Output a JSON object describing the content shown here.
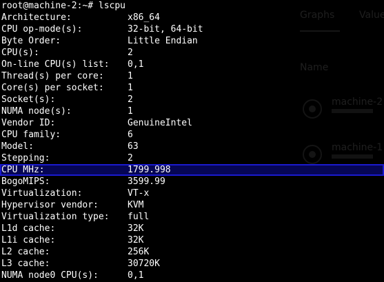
{
  "terminal": {
    "prompt": "root@machine-2:~# lscpu",
    "rows": [
      {
        "key": "Architecture:",
        "value": "x86_64"
      },
      {
        "key": "CPU op-mode(s):",
        "value": "32-bit, 64-bit"
      },
      {
        "key": "Byte Order:",
        "value": "Little Endian"
      },
      {
        "key": "CPU(s):",
        "value": "2"
      },
      {
        "key": "On-line CPU(s) list:",
        "value": "0,1"
      },
      {
        "key": "Thread(s) per core:",
        "value": "1"
      },
      {
        "key": "Core(s) per socket:",
        "value": "1"
      },
      {
        "key": "Socket(s):",
        "value": "2"
      },
      {
        "key": "NUMA node(s):",
        "value": "1"
      },
      {
        "key": "Vendor ID:",
        "value": "GenuineIntel"
      },
      {
        "key": "CPU family:",
        "value": "6"
      },
      {
        "key": "Model:",
        "value": "63"
      },
      {
        "key": "Stepping:",
        "value": "2"
      },
      {
        "key": "CPU MHz:",
        "value": "1799.998"
      },
      {
        "key": "BogoMIPS:",
        "value": "3599.99"
      },
      {
        "key": "Virtualization:",
        "value": "VT-x"
      },
      {
        "key": "Hypervisor vendor:",
        "value": "KVM"
      },
      {
        "key": "Virtualization type:",
        "value": "full"
      },
      {
        "key": "L1d cache:",
        "value": "32K"
      },
      {
        "key": "L1i cache:",
        "value": "32K"
      },
      {
        "key": "L2 cache:",
        "value": "256K"
      },
      {
        "key": "L3 cache:",
        "value": "30720K"
      },
      {
        "key": "NUMA node0 CPU(s):",
        "value": "0,1"
      }
    ],
    "highlighted_row": "CPU MHz:",
    "colors": {
      "background": "#000000",
      "text": "#ffffff",
      "highlight_fill": "#060654",
      "highlight_border": "#1a1ad0"
    }
  },
  "background_window": {
    "tabs": [
      "Graphs",
      "Values"
    ],
    "column_header": "Name",
    "rows": [
      {
        "name": "machine-2",
        "icon": "node-icon"
      },
      {
        "name": "machine-1",
        "icon": "node-icon"
      }
    ]
  }
}
